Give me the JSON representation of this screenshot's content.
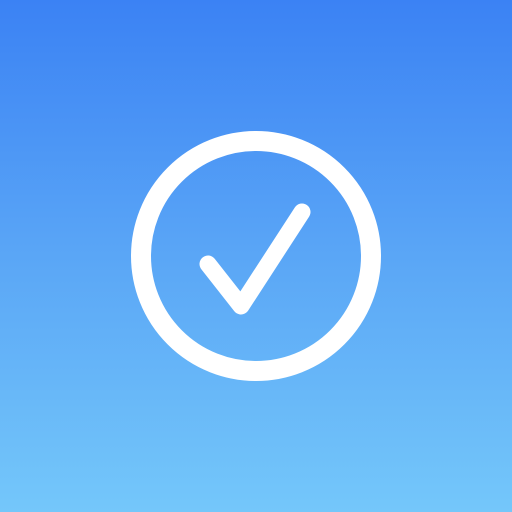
{
  "app_icon": {
    "icon": "check-circle-icon",
    "colors": {
      "gradient_top": "#3B82F4",
      "gradient_mid": "#5AA6F6",
      "gradient_bottom": "#74C7FA",
      "glyph": "#FFFFFF"
    }
  }
}
